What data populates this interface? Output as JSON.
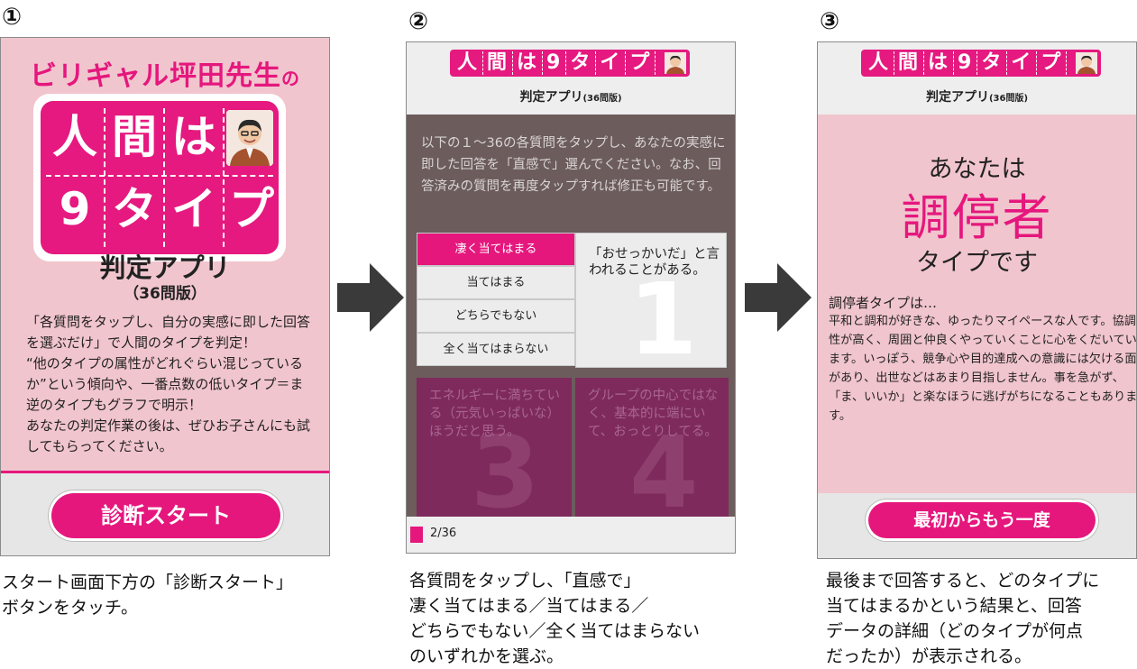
{
  "steps": [
    {
      "number": "①",
      "caption": "スタート画面下方の「診断スタート」\nボタンをタッチ。"
    },
    {
      "number": "②",
      "caption": "各質問をタップし、「直感で」\n凄く当てはまる／当てはまる／\nどちらでもない／全く当てはまらない\nのいずれかを選ぶ。"
    },
    {
      "number": "③",
      "caption": "最後まで回答すると、どのタイプに\n当てはまるかという結果と、回答\nデータの詳細（どのタイプが何点\nだったか）が表示される。"
    }
  ],
  "screen1": {
    "top_title": "ビリギャル坪田先生",
    "top_title_suffix": "の",
    "logo_row1": [
      "人",
      "間",
      "は"
    ],
    "logo_row2": [
      "9",
      "タ",
      "イ",
      "プ"
    ],
    "app_title": "判定アプリ",
    "app_subtitle": "（36問版）",
    "description": "「各質問をタップし、自分の実感に即した回答を選ぶだけ」で人間のタイプを判定！\n“他のタイプの属性がどれぐらい混じっているか”という傾向や、一番点数の低いタイプ＝ま逆のタイプもグラフで明示！\nあなたの判定作業の後は、ぜひお子さんにも試してもらってください。",
    "start_button": "診断スタート"
  },
  "mini_logo": {
    "cells": [
      "人",
      "間",
      "は",
      "9",
      "タ",
      "イ",
      "プ"
    ],
    "sub": "判定アプリ",
    "sub_small": "(36問版)"
  },
  "screen2": {
    "instructions": "以下の１～36の各質問をタップし、あなたの実感に即した回答を「直感で」選んでください。なお、回答済みの質問を再度タップすれば修正も可能です。",
    "answers": [
      "凄く当てはまる",
      "当てはまる",
      "どちらでもない",
      "全く当てはまらない"
    ],
    "selected_answer": "凄く当てはまる",
    "question": {
      "number": "1",
      "text": "「おせっかいだ」と言われることがある。"
    },
    "next_questions": [
      {
        "number": "3",
        "text": "エネルギーに満ちている（元気いっぱいな）ほうだと思う。"
      },
      {
        "number": "4",
        "text": "グループの中心ではなく、基本的に端にいて、おっとりしてる。"
      }
    ],
    "progress": "2/36"
  },
  "screen3": {
    "anata": "あなたは",
    "type_name": "調停者",
    "desu": "タイプです",
    "heading": "調停者タイプは…",
    "description": "平和と調和が好きな、ゆったりマイペースな人です。協調性が高く、周囲と仲良くやっていくことに心をくだいています。いっぽう、競争心や目的達成への意識には欠ける面があり、出世などはあまり目指しません。事を急がず、「ま、いいか」と楽なほうに逃げがちになることもあります。",
    "restart_button": "最初からもう一度"
  },
  "colors": {
    "accent": "#e5177d",
    "pink_bg": "#f1c5ce",
    "dark_bg": "#6c5c5c",
    "arrow": "#3a3a3a"
  }
}
